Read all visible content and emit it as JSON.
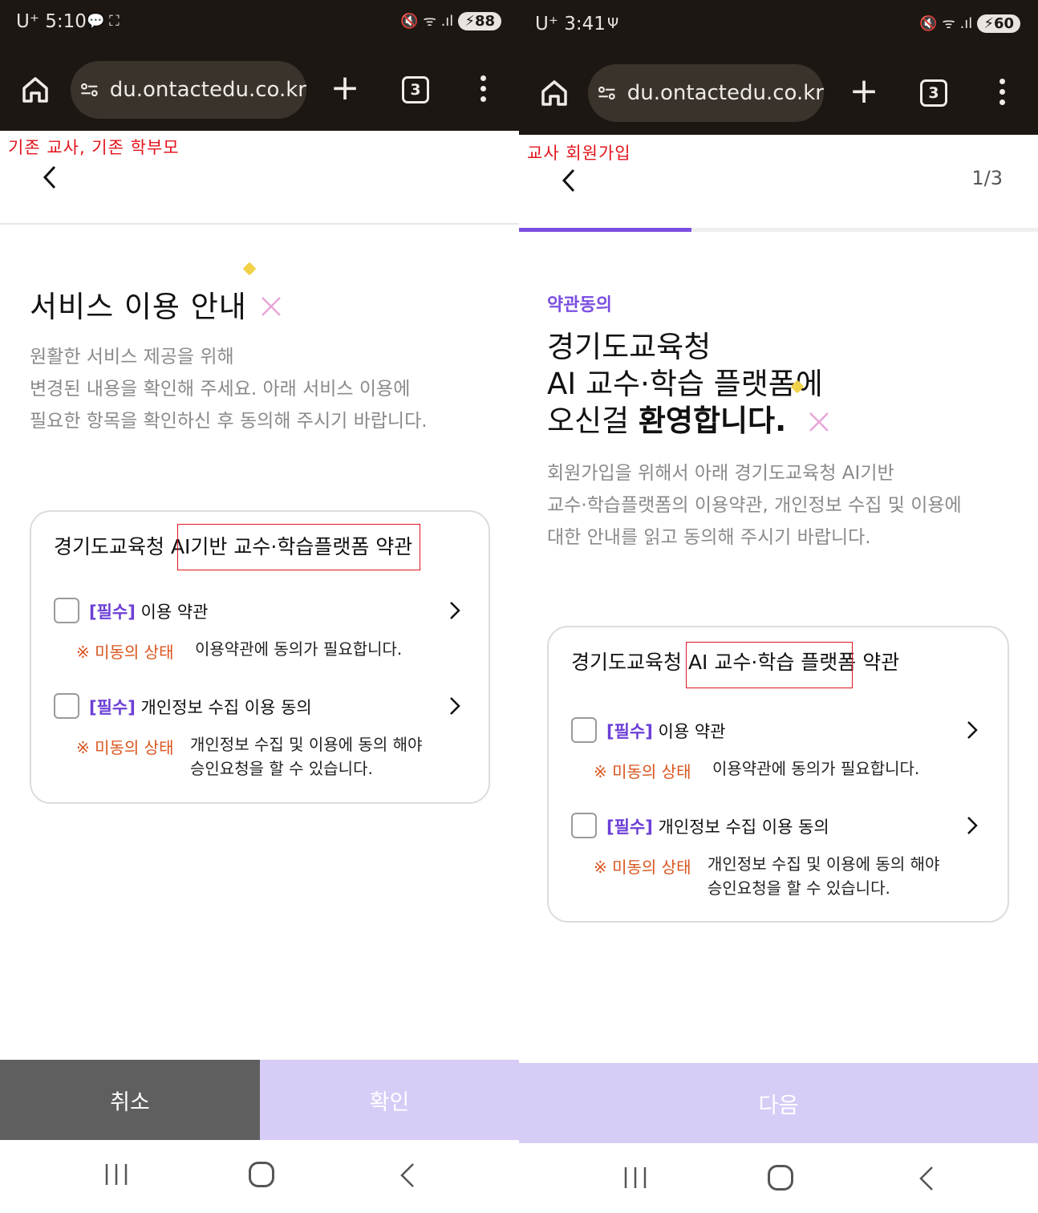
{
  "left": {
    "status": {
      "time": "U⁺ 5:10",
      "extra": "💬 ⛶",
      "icons": "🔇 ᯤ .ıl",
      "battery": "⚡88"
    },
    "browser": {
      "url": "du.ontactedu.co.kr",
      "plus": "+",
      "tab_count": "3"
    },
    "annotation": "기존 교사, 기존 학부모",
    "headline": "서비스 이용 안내",
    "description": [
      "원활한 서비스 제공을 위해",
      "변경된 내용을 확인해 주세요. 아래 서비스 이용에",
      "필요한 항목을 확인하신 후 동의해 주시기 바랍니다."
    ],
    "card": {
      "title_prefix": "경기도교육청 ",
      "title_highlight": "AI기반 교수·학습플랫폼",
      "title_suffix": " 약관",
      "items": [
        {
          "tag": "[필수]",
          "label": " 이용 약관",
          "status": "※ 미동의 상태",
          "message": "이용약관에 동의가 필요합니다."
        },
        {
          "tag": "[필수]",
          "label": " 개인정보 수집 이용 동의",
          "status": "※ 미동의 상태",
          "message": "개인정보 수집 및 이용에 동의 해야",
          "message2": "승인요청을 할 수 있습니다."
        }
      ]
    },
    "buttons": {
      "cancel": "취소",
      "confirm": "확인"
    }
  },
  "right": {
    "status": {
      "time": "U⁺ 3:41",
      "extra": "Ψ",
      "icons": "🔇 ᯤ .ıl",
      "battery": "⚡60"
    },
    "browser": {
      "url": "du.ontactedu.co.kr",
      "plus": "+",
      "tab_count": "3"
    },
    "annotation": "교사 회원가입",
    "step": "1/3",
    "progress_fraction": 0.333,
    "eyebrow": "약관동의",
    "title_line1": "경기도교육청",
    "title_line2": "AI 교수·학습 플랫폼에",
    "title_line3_plain": "오신걸 ",
    "title_line3_bold": "환영합니다.",
    "description": [
      "회원가입을 위해서 아래 경기도교육청 AI기반",
      "교수·학습플랫폼의 이용약관, 개인정보 수집 및 이용에",
      "대한 안내를 읽고 동의해 주시기 바랍니다."
    ],
    "card": {
      "title_prefix": "경기도교육청 ",
      "title_highlight": "AI 교수·학습 플랫폼",
      "title_suffix": " 약관",
      "items": [
        {
          "tag": "[필수]",
          "label": " 이용 약관",
          "status": "※ 미동의 상태",
          "message": "이용약관에 동의가 필요합니다."
        },
        {
          "tag": "[필수]",
          "label": " 개인정보 수집 이용 동의",
          "status": "※ 미동의 상태",
          "message": "개인정보 수집 및 이용에 동의 해야",
          "message2": "승인요청을 할 수 있습니다."
        }
      ]
    },
    "buttons": {
      "next": "다음"
    }
  },
  "colors": {
    "accent": "#7b4fe0",
    "disabled_button": "#d7ccf6",
    "cancel_button": "#5f5f5f",
    "warning": "#d9541d",
    "annotation": "#e2151c"
  },
  "icons": [
    "home-icon",
    "tune-icon",
    "plus-icon",
    "tabs-icon",
    "kebab-icon",
    "back-chevron-icon",
    "chevron-right-icon",
    "checkbox-icon",
    "recents-icon",
    "nav-home-icon",
    "nav-back-icon"
  ]
}
